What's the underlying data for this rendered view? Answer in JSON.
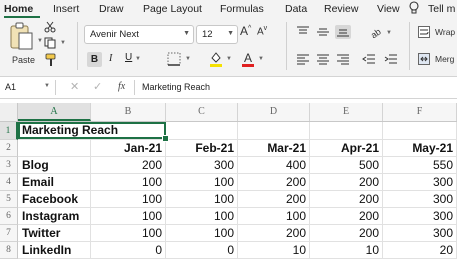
{
  "ribbon_tabs": [
    "Home",
    "Insert",
    "Draw",
    "Page Layout",
    "Formulas",
    "Data",
    "Review",
    "View",
    "Tell m"
  ],
  "ribbon": {
    "paste_label": "Paste",
    "font_name": "Avenir Next",
    "font_size": "12",
    "bold_label": "B",
    "italic_label": "I",
    "underline_label": "U",
    "grow_font": "A",
    "shrink_font": "A",
    "wrap_label": "Wrap",
    "merge_label": "Merg",
    "accent_color": "#1e7145",
    "font_color": "#e02020",
    "fill_color": "#f5e100"
  },
  "formula_bar": {
    "name_box": "A1",
    "fx_label": "fx",
    "content": "Marketing Reach"
  },
  "grid": {
    "columns": [
      "A",
      "B",
      "C",
      "D",
      "E",
      "F"
    ],
    "rows": [
      "1",
      "2",
      "3",
      "4",
      "5",
      "6",
      "7",
      "8"
    ],
    "title": "Marketing Reach",
    "months": [
      "Jan-21",
      "Feb-21",
      "Mar-21",
      "Apr-21",
      "May-21"
    ],
    "data": [
      {
        "label": "Blog",
        "values": [
          "200",
          "300",
          "400",
          "500",
          "550"
        ]
      },
      {
        "label": "Email",
        "values": [
          "100",
          "100",
          "200",
          "200",
          "300"
        ]
      },
      {
        "label": "Facebook",
        "values": [
          "100",
          "100",
          "200",
          "200",
          "300"
        ]
      },
      {
        "label": "Instagram",
        "values": [
          "100",
          "100",
          "100",
          "200",
          "300"
        ]
      },
      {
        "label": "Twitter",
        "values": [
          "100",
          "100",
          "200",
          "200",
          "300"
        ]
      },
      {
        "label": "LinkedIn",
        "values": [
          "0",
          "0",
          "10",
          "10",
          "20"
        ]
      }
    ]
  }
}
